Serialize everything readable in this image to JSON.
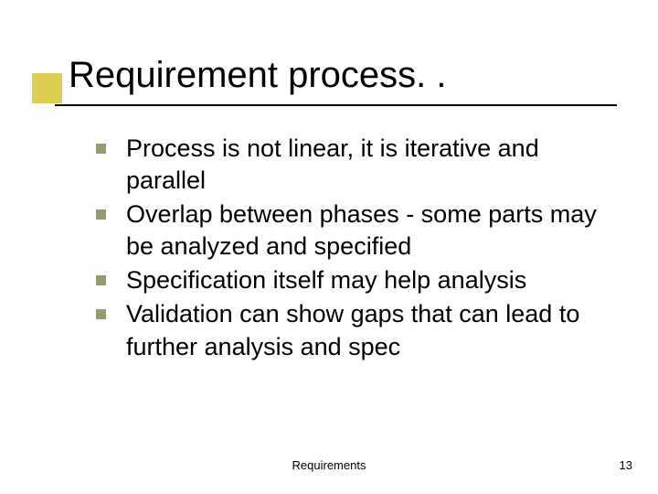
{
  "title": "Requirement process. .",
  "bullets": [
    "Process is not linear, it is iterative and parallel",
    "Overlap between phases - some parts may be analyzed and specified",
    "Specification itself may help analysis",
    "Validation can show gaps that can lead to further analysis and spec"
  ],
  "footer": {
    "center": "Requirements",
    "page": "13"
  }
}
